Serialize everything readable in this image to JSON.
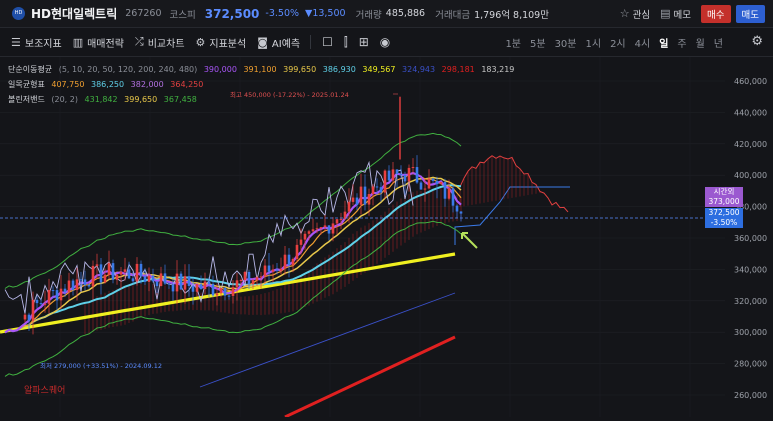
{
  "header": {
    "logo_text": "HD",
    "name": "HD현대일렉트릭",
    "code": "267260",
    "market": "코스피",
    "price": "372,500",
    "change_pct": "-3.50%",
    "change_abs": "▼13,500",
    "volume_label": "거래량",
    "volume": "485,886",
    "turnover_label": "거래대금",
    "turnover": "1,796억 8,109만",
    "watch_label": "관심",
    "memo_label": "메모",
    "buy_label": "매수",
    "sell_label": "매도"
  },
  "toolbar": {
    "items": [
      "보조지표",
      "매매전략",
      "비교차트",
      "지표분석",
      "AI예측"
    ],
    "periods": [
      "1분",
      "5분",
      "30분",
      "1시",
      "2시",
      "4시",
      "일",
      "주",
      "월",
      "년"
    ],
    "active_period": "일"
  },
  "legend": {
    "sma_label": "단순이동평균",
    "sma_params": "(5, 10, 20, 50, 120, 200, 240, 480)",
    "sma_values": [
      "390,000",
      "391,100",
      "399,650",
      "386,930",
      "349,567",
      "324,943",
      "298,181",
      "183,219"
    ],
    "sma_colors": [
      "#a855f7",
      "#f0a030",
      "#e8c84a",
      "#5fd0e8",
      "#f0f020",
      "#3a50c8",
      "#e02020",
      "#c8c8c8"
    ],
    "ichimoku_label": "일목균형표",
    "ichimoku_values": [
      "407,750",
      "386,250",
      "382,000",
      "364,250"
    ],
    "ichimoku_colors": [
      "#f0a030",
      "#5fd0e8",
      "#b070e0",
      "#e04040"
    ],
    "bb_label": "볼린저밴드",
    "bb_params": "(20, 2)",
    "bb_values": [
      "431,842",
      "399,650",
      "367,458"
    ],
    "bb_colors": [
      "#40b040",
      "#e8c84a",
      "#40b040"
    ]
  },
  "annotations": {
    "high": "최고 450,000 (-17.22%) - 2025.01.24",
    "low": "최저 279,000 (+33.51%) - 2024.09.12",
    "watermark": "알파스퀘어"
  },
  "axis": {
    "y_ticks": [
      "460,000",
      "440,000",
      "420,000",
      "400,000",
      "380,000",
      "360,000",
      "340,000",
      "320,000",
      "300,000",
      "280,000",
      "260,000"
    ]
  },
  "tags": {
    "cur_label": "시간외",
    "cur_value": "373,000",
    "close_value": "372,500",
    "close_pct": "-3.50%"
  }
}
